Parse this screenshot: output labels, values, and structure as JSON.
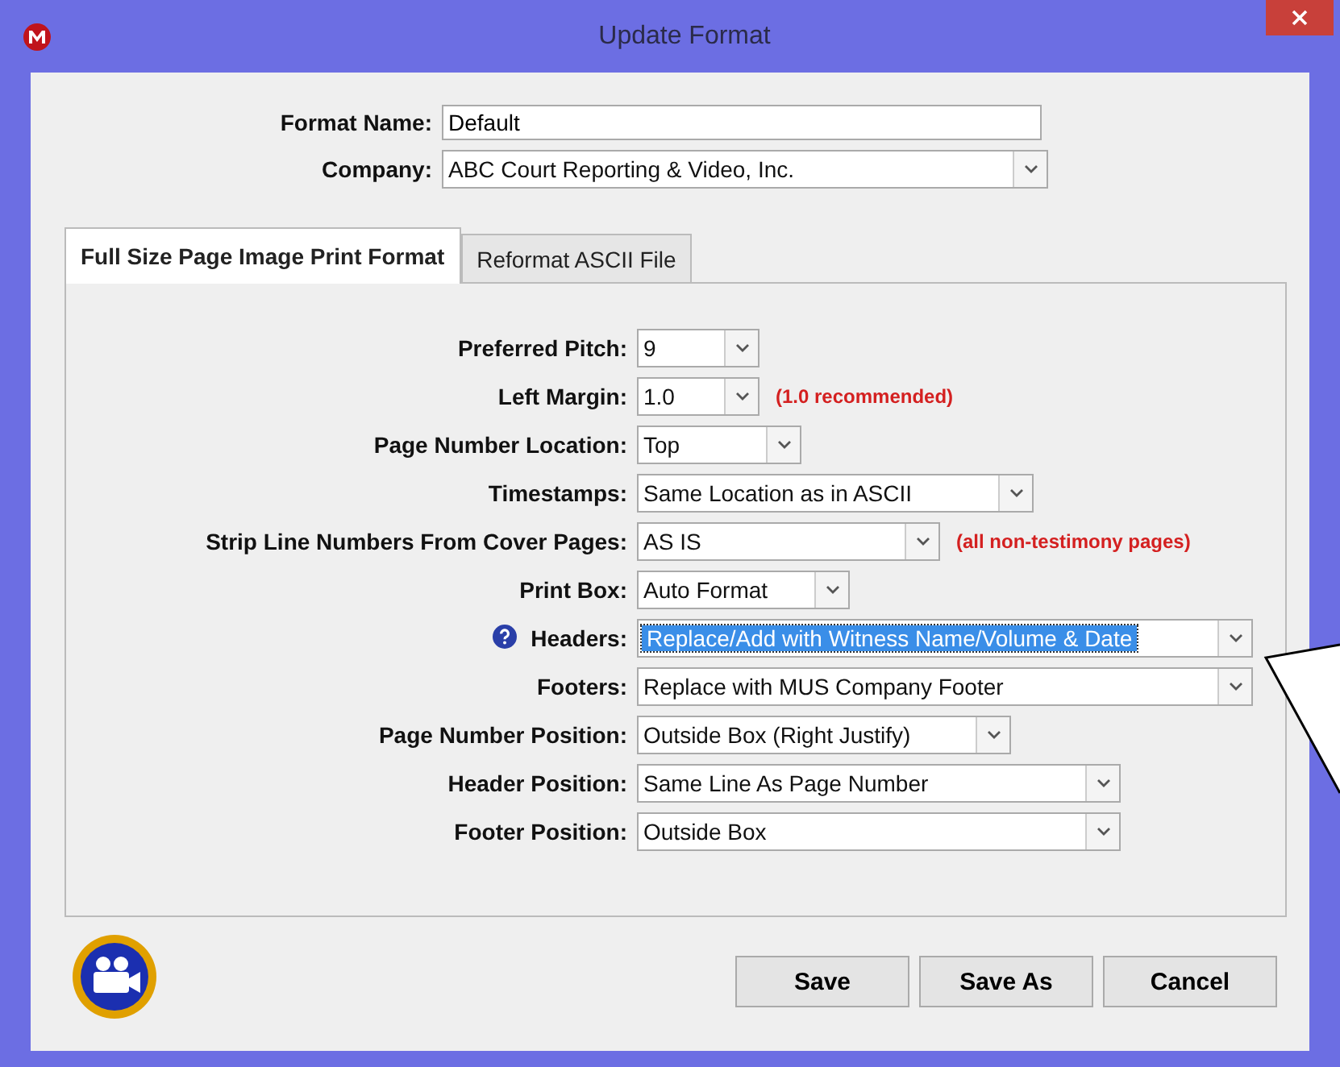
{
  "window": {
    "title": "Update Format"
  },
  "format_name": {
    "label": "Format Name:",
    "value": "Default"
  },
  "company": {
    "label": "Company:",
    "value": "ABC Court Reporting & Video, Inc."
  },
  "tabs": [
    {
      "label": "Full Size Page Image Print Format",
      "selected": true
    },
    {
      "label": "Reformat ASCII File",
      "selected": false
    }
  ],
  "fields": [
    {
      "label": "Preferred Pitch:",
      "value": "9",
      "focused": false,
      "help": false
    },
    {
      "label": "Left Margin:",
      "value": "1.0",
      "note": "(1.0 recommended)",
      "focused": false,
      "help": false
    },
    {
      "label": "Page Number Location:",
      "value": "Top",
      "focused": false,
      "help": false
    },
    {
      "label": "Timestamps:",
      "value": "Same Location as in ASCII",
      "focused": false,
      "help": false
    },
    {
      "label": "Strip Line Numbers From Cover Pages:",
      "value": "AS IS",
      "note": "(all non-testimony pages)",
      "focused": false,
      "help": false
    },
    {
      "label": "Print Box:",
      "value": "Auto Format",
      "focused": false,
      "help": false
    },
    {
      "label": "Headers:",
      "value": "Replace/Add with Witness Name/Volume & Date",
      "focused": true,
      "help": true
    },
    {
      "label": "Footers:",
      "value": "Replace with MUS Company Footer",
      "focused": false,
      "help": false
    },
    {
      "label": "Page Number Position:",
      "value": "Outside Box (Right Justify)",
      "focused": false,
      "help": false
    },
    {
      "label": "Header Position:",
      "value": "Same Line As Page Number",
      "focused": false,
      "help": false
    },
    {
      "label": "Footer Position:",
      "value": "Outside Box",
      "focused": false,
      "help": false
    }
  ],
  "buttons": [
    "Save",
    "Save As",
    "Cancel"
  ]
}
